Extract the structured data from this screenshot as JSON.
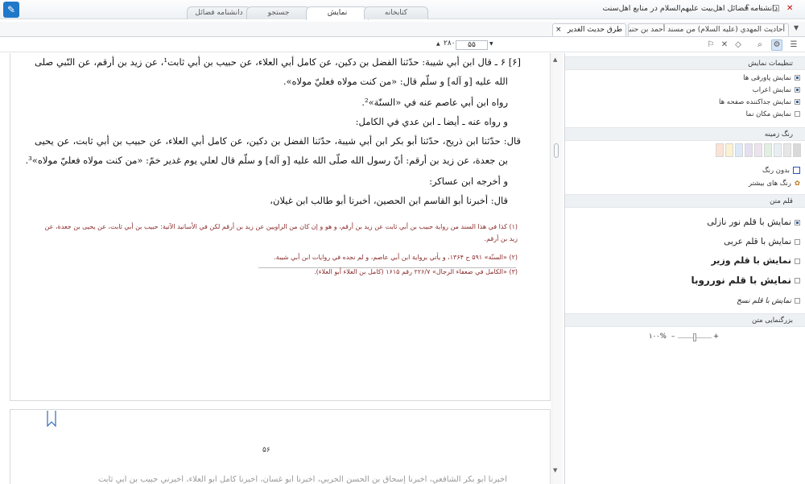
{
  "window": {
    "title": "دانشنامه فضائل اهل‌بیت علیهم‌السلام در منابع اهل‌سنت",
    "help": "؟",
    "minimize": "–",
    "maximize": "□",
    "close": "✕"
  },
  "main_tabs": [
    {
      "label": "کتابخانه"
    },
    {
      "label": "نمایش"
    },
    {
      "label": "جستجو"
    },
    {
      "label": "دانشنامه فضائل"
    }
  ],
  "doc_tabs": [
    {
      "label": "أحاديث المهدي (عليه السلام) من مسند أحمد بن حنبل"
    },
    {
      "label": "طرق حديث الغدير",
      "close": "×"
    }
  ],
  "toolbar": {
    "page_current": "۵۵",
    "page_total": "۲۸۰",
    "arrow_up": "▲",
    "arrow_down": "▼"
  },
  "reader": {
    "lines": [
      "[۶] ۶ ـ قال ابن أبي شيبة: حدّثنا الفضل بن دكين، عن كامل أبي العلاء، عن حبيب بن أبي ثابت¹، عن زيد بن أرقم، عن النّبي صلى",
      "الله عليه [و آله] و سلّم قال: «من كنت مولاه فعليّ مولاه».",
      "رواه ابن أبي عاصم عنه في «السنّة»².",
      "و رواه عنه ـ أيضا ـ ابن عدي في الكامل:",
      "قال: حدّثنا ابن ذريح، حدّثنا أبو بكر ابن أبي شيبة، حدّثنا الفضل بن دكين، عن كامل أبي العلاء، عن حبيب بن أبي ثابت، عن يحيى",
      "بن جعدة، عن زيد بن أرقم: أنّ رسول الله صلّى الله عليه [و آله] و سلّم قال لعلي يوم غدير خمّ: «من كنت مولاه فعليّ مولاه»³.",
      "و أخرجه ابن عساكر:",
      "قال: أخبرنا أبو القاسم ابن الحصين، أخبرنا أبو طالب ابن غيلان،"
    ],
    "footnotes": [
      "(۱) كذا في هذا السند من رواية حبيب بن أبي ثابت عن زيد بن أرقم، و هو و إن كان من الراويين عن زيد بن أرقم لكن في الأسانيد الآتية: حبيب بن أبي ثابت، عن يحيى بن جعدة، عن زيد بن أرقم.",
      "(۲) «السنّة» ۵۹۱ ح ۱۳۶۴، و يأتي برواية ابن أبي عاصم، و لم نجده في روايات ابن أبي شيبة.",
      "(۳) «الكامل في ضعفاء الرجال» ۲۲۶/۷ رقم ۱۶۱۵ (كامل بن العلاء أبو العلاء)."
    ],
    "page_number": "۵۶",
    "next_page_line": "أخبرنا أبو بكر الشافعي، أخبرنا إسحاق بن الحسن الحربي، أخبرنا أبو غسان، أخبرنا كامل أبو العلاء، أخبرني حبيب بن أبي ثابت"
  },
  "sidebar": {
    "display_settings": {
      "header": "تنظیمات نمایش",
      "options": [
        {
          "label": "نمایش پاورقی ها",
          "checked": true
        },
        {
          "label": "نمایش اعراب",
          "checked": true
        },
        {
          "label": "نمایش جداکننده صفحه ها",
          "checked": true
        },
        {
          "label": "نمایش مکان نما",
          "checked": false
        }
      ]
    },
    "background": {
      "header": "رنگ زمینه",
      "swatches": [
        "#fbe3d4",
        "#fbf2d2",
        "#dde9f7",
        "#e5dff0",
        "#ece3ef",
        "#e0f0e2",
        "#e8eff4",
        "#e6e6e6",
        "#d9d9d9"
      ],
      "no_color": "بدون رنگ",
      "more_colors": "رنگ های بیشتر"
    },
    "font": {
      "header": "قلم متن",
      "options": [
        {
          "label": "نمایش با قلم نور نازلی",
          "checked": true
        },
        {
          "label": "نمایش با قلم عربی",
          "checked": false
        },
        {
          "label": "نمایش با قلم وزیر",
          "checked": false
        },
        {
          "label": "نمایش با قلم نورروبا",
          "checked": false
        },
        {
          "label": "نمایش با قلم نسخ",
          "checked": false
        }
      ]
    },
    "zoom": {
      "header": "بزرگنمایی متن",
      "value": "۱۰۰%",
      "minus": "–",
      "plus": "+",
      "level_percent": 50
    }
  }
}
